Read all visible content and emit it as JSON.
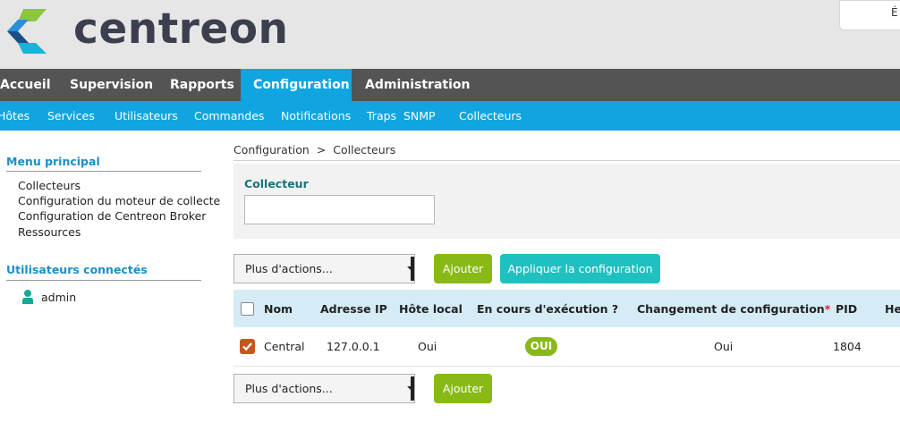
{
  "header": {
    "logo_text": "centreon",
    "top_right_text": "É"
  },
  "main_nav": {
    "items": [
      {
        "label": "Accueil"
      },
      {
        "label": "Supervision"
      },
      {
        "label": "Rapports"
      },
      {
        "label": "Configuration",
        "active": true
      },
      {
        "label": "Administration"
      }
    ]
  },
  "sub_nav": {
    "items": [
      {
        "label": "Hôtes"
      },
      {
        "label": "Services"
      },
      {
        "label": "Utilisateurs"
      },
      {
        "label": "Commandes"
      },
      {
        "label": "Notifications"
      },
      {
        "label": "Traps  SNMP"
      },
      {
        "label": "Collecteurs"
      }
    ]
  },
  "sidebar": {
    "main_menu_title": "Menu principal",
    "links": [
      "Collecteurs",
      "Configuration du moteur de collecte",
      "Configuration de Centreon Broker",
      "Ressources"
    ],
    "users_title": "Utilisateurs connectés",
    "users": [
      "admin"
    ]
  },
  "breadcrumb": {
    "items": [
      "Configuration",
      "Collecteurs"
    ],
    "separator": ">"
  },
  "filter": {
    "label": "Collecteur",
    "value": ""
  },
  "actions": {
    "more_actions_top": "Plus d'actions...",
    "add_top": "Ajouter",
    "apply_config": "Appliquer la configuration",
    "more_actions_bottom": "Plus d'actions...",
    "add_bottom": "Ajouter"
  },
  "table": {
    "columns": [
      "Nom",
      "Adresse IP",
      "Hôte local",
      "En cours d'exécution ?",
      "Changement de configuration",
      "PID",
      "He"
    ],
    "required_marker": "*",
    "rows": [
      {
        "checked": true,
        "name": "Central",
        "ip": "127.0.0.1",
        "local_host": "Oui",
        "running": "OUI",
        "config_changed": "Oui",
        "pid": "1804"
      }
    ]
  },
  "colors": {
    "header_bg": "#e6e6e6",
    "main_nav_bg": "#545454",
    "accent_blue": "#10a5e0",
    "button_green": "#88b917",
    "button_teal": "#1ec0c0",
    "checkbox_checked": "#c9561d",
    "table_header_bg": "#d5ecf7"
  },
  "icons": {
    "logo": "centreon-logo-icon",
    "user": "user-icon",
    "checkbox": "checkbox-icon",
    "dropdown": "dropdown-arrow-icon"
  }
}
